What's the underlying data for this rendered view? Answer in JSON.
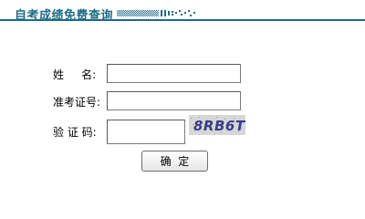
{
  "header": {
    "title": "自考成绩免费查询"
  },
  "form": {
    "name_label": "姓     名:",
    "name_value": "",
    "id_label": "准考证号:",
    "id_value": "",
    "captcha_label": "验 证 码:",
    "captcha_value": "",
    "captcha_text": "8RB6T",
    "submit_label": "确  定"
  },
  "colors": {
    "accent": "#1d6b86",
    "captcha_text": "#3a3a8c"
  }
}
